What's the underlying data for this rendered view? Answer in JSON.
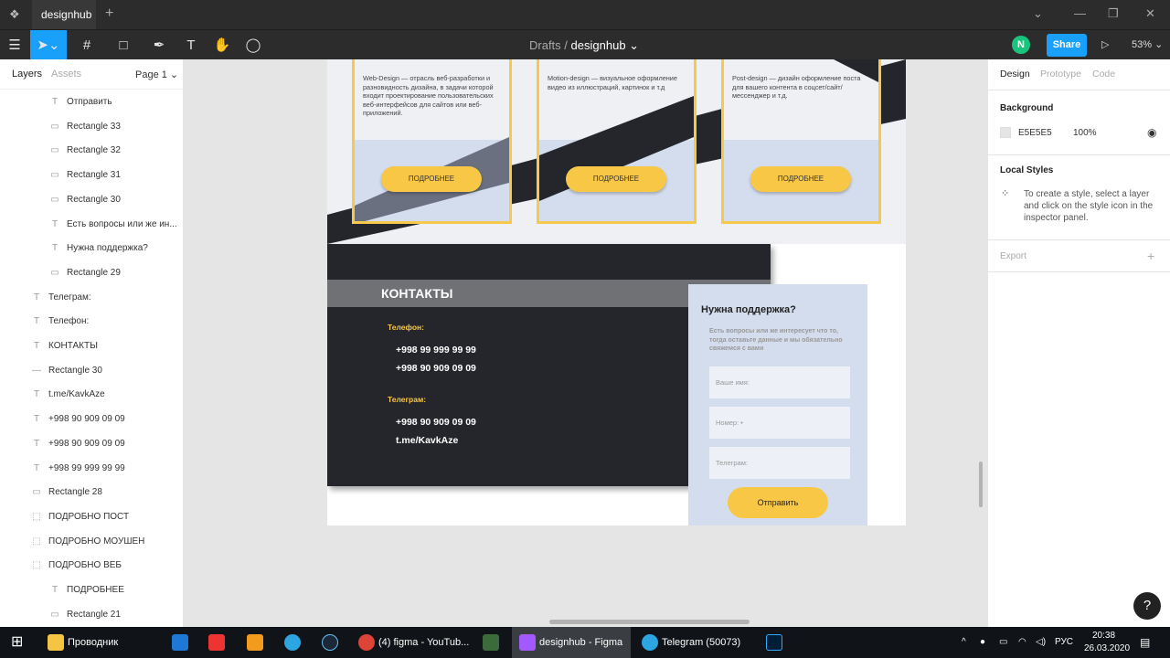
{
  "titlebar": {
    "tab_label": "designhub",
    "add_label": "+"
  },
  "toolbar": {
    "breadcrumb_parent": "Drafts",
    "breadcrumb_separator": "/",
    "breadcrumb_file": "designhub",
    "avatar_letter": "N",
    "share_label": "Share",
    "zoom_label": "53%"
  },
  "left_panel": {
    "tabs": [
      "Layers",
      "Assets"
    ],
    "page_label": "Page 1",
    "layers": [
      {
        "name": "Отправить",
        "icon": "text-icon",
        "indent": 2
      },
      {
        "name": "Rectangle 33",
        "icon": "rectangle-icon",
        "indent": 2
      },
      {
        "name": "Rectangle 32",
        "icon": "rectangle-icon",
        "indent": 2
      },
      {
        "name": "Rectangle 31",
        "icon": "rectangle-icon",
        "indent": 2
      },
      {
        "name": "Rectangle 30",
        "icon": "rectangle-icon",
        "indent": 2
      },
      {
        "name": "Есть вопросы или же ин...",
        "icon": "text-icon",
        "indent": 2
      },
      {
        "name": "Нужна поддержка?",
        "icon": "text-icon",
        "indent": 2
      },
      {
        "name": "Rectangle 29",
        "icon": "rectangle-icon",
        "indent": 2
      },
      {
        "name": "Телеграм:",
        "icon": "text-icon",
        "indent": 1
      },
      {
        "name": "Телефон:",
        "icon": "text-icon",
        "indent": 1
      },
      {
        "name": "КОНТАКТЫ",
        "icon": "text-icon",
        "indent": 1
      },
      {
        "name": "Rectangle 30",
        "icon": "line-icon",
        "indent": 1
      },
      {
        "name": "t.me/KavkAze",
        "icon": "text-icon",
        "indent": 1
      },
      {
        "name": "+998 90 909 09 09",
        "icon": "text-icon",
        "indent": 1
      },
      {
        "name": "+998 90 909 09 09",
        "icon": "text-icon",
        "indent": 1
      },
      {
        "name": "+998 99 999 99 99",
        "icon": "text-icon",
        "indent": 1
      },
      {
        "name": "Rectangle 28",
        "icon": "rectangle-icon",
        "indent": 1
      },
      {
        "name": "ПОДРОБНО ПОСТ",
        "icon": "group-icon",
        "indent": 1
      },
      {
        "name": "ПОДРОБНО МОУШЕН",
        "icon": "group-icon",
        "indent": 1
      },
      {
        "name": "ПОДРОБНО ВЕБ",
        "icon": "group-icon",
        "indent": 1
      },
      {
        "name": "ПОДРОБНЕЕ",
        "icon": "text-icon",
        "indent": 2
      },
      {
        "name": "Rectangle 21",
        "icon": "rectangle-icon",
        "indent": 2
      }
    ]
  },
  "canvas": {
    "cards": [
      {
        "text": "Web-Design — отрасль веб-разработки и разновидность дизайна, в задачи которой входит проектирование пользовательских веб-интерфейсов для сайтов или веб-приложений.",
        "button": "ПОДРОБНЕЕ"
      },
      {
        "text": "Motion-design — визуальное оформление видео из иллюстраций, картинок и т.д",
        "button": "ПОДРОБНЕЕ"
      },
      {
        "text": "Post-design — дизайн оформление поста для вашего контента в соцсет/сайт/мессенджер и т.д.",
        "button": "ПОДРОБНЕЕ"
      }
    ],
    "contacts": {
      "title": "КОНТАКТЫ",
      "phone_label": "Телефон:",
      "phone_1": "+998 99 999 99 99",
      "phone_2": "+998 90 909 09 09",
      "telegram_label": "Телеграм:",
      "telegram_phone": "+998 90 909 09 09",
      "telegram_link": "t.me/KavkAze"
    },
    "support": {
      "title": "Нужна поддержка?",
      "text": "Есть вопросы или же интересует что то, тогда оставьте данные и мы обязательно свяжемся с вами",
      "name_placeholder": "Ваше имя:",
      "phone_placeholder": "Номер: •",
      "telegram_placeholder": "Телеграм:",
      "send_label": "Отправить"
    }
  },
  "right_panel": {
    "tabs": [
      "Design",
      "Prototype",
      "Code"
    ],
    "background_label": "Background",
    "background_hex": "E5E5E5",
    "background_opacity": "100%",
    "local_styles_label": "Local Styles",
    "local_styles_hint": "To create a style, select a layer and click on the style icon in the inspector panel.",
    "export_label": "Export",
    "export_add": "+"
  },
  "taskbar": {
    "explorer": "Проводник",
    "chrome": "(4) figma - YouTub...",
    "figma": "designhub - Figma",
    "telegram": "Telegram (50073)",
    "language": "РУС",
    "time": "20:38",
    "date": "26.03.2020"
  },
  "colors": {
    "accent": "#18a0fb",
    "card_border": "#f4c94c",
    "button_yellow": "#f8c745",
    "dark_panel": "#24262c",
    "light_blue": "#d4ddee"
  }
}
